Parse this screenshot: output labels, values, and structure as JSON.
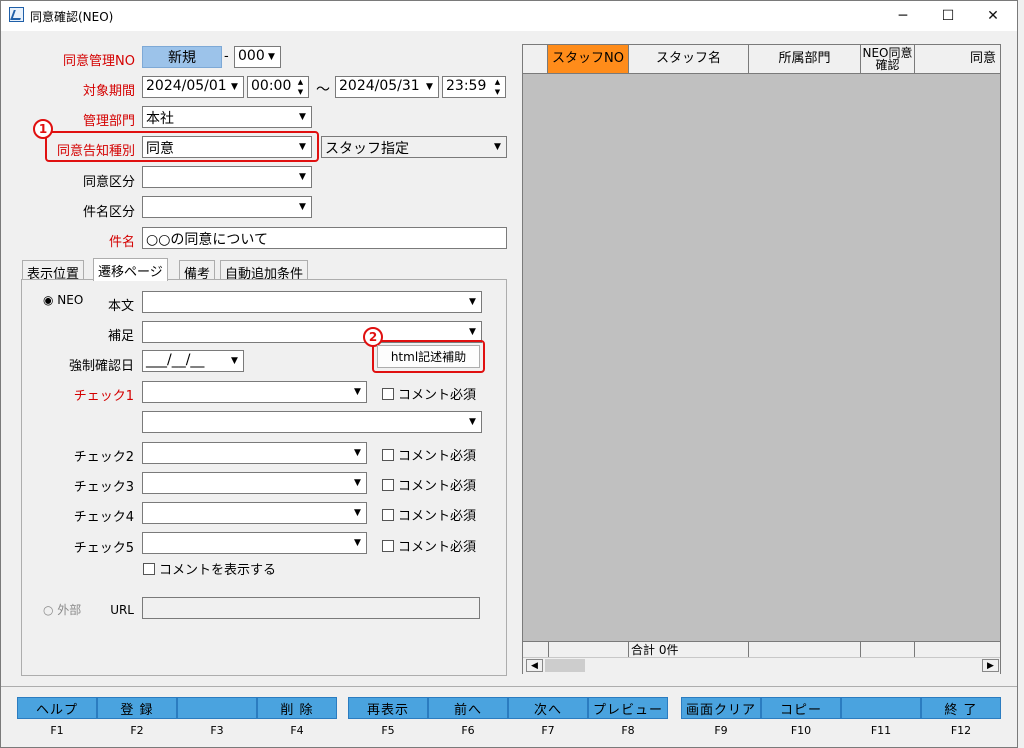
{
  "window": {
    "title": "同意確認(NEO)"
  },
  "form": {
    "mgmt_no_label": "同意管理NO",
    "mgmt_no_value": "新規",
    "mgmt_no_dash": "-",
    "mgmt_no_sub": "000",
    "period_label": "対象期間",
    "period_from_date": "2024/05/01",
    "period_from_time": "00:00",
    "period_sep": "～",
    "period_to_date": "2024/05/31",
    "period_to_time": "23:59",
    "dept_label": "管理部門",
    "dept_value": "本社",
    "notice_type_label": "同意告知種別",
    "notice_type_value": "同意",
    "staff_spec_value": "スタッフ指定",
    "consent_class_label": "同意区分",
    "subject_class_label": "件名区分",
    "subject_label": "件名",
    "subject_value": "○○の同意について"
  },
  "tabs": [
    "表示位置",
    "遷移ページ",
    "備考",
    "自動追加条件"
  ],
  "panel": {
    "neo_radio": "NEO",
    "body_label": "本文",
    "supplement_label": "補足",
    "force_date_label": "強制確認日",
    "force_date_value": "___/__/__",
    "html_button": "html記述補助",
    "check1_label": "チェック1",
    "check2_label": "チェック2",
    "check3_label": "チェック3",
    "check4_label": "チェック4",
    "check5_label": "チェック5",
    "comment_required": "コメント必須",
    "show_comment": "コメントを表示する",
    "external_radio": "外部",
    "url_label": "URL"
  },
  "grid": {
    "columns": [
      "スタッフNO",
      "スタッフ名",
      "所属部門",
      "NEO同意確認",
      "同意"
    ],
    "footer_total": "合計 0件"
  },
  "badges": [
    "1",
    "2"
  ],
  "fkeys": [
    {
      "label": "ヘルプ",
      "key": "F1"
    },
    {
      "label": "登 録",
      "key": "F2"
    },
    {
      "label": "",
      "key": "F3"
    },
    {
      "label": "削 除",
      "key": "F4"
    },
    {
      "label": "再表示",
      "key": "F5"
    },
    {
      "label": "前へ",
      "key": "F6"
    },
    {
      "label": "次へ",
      "key": "F7"
    },
    {
      "label": "プレビュー",
      "key": "F8"
    },
    {
      "label": "画面クリア",
      "key": "F9"
    },
    {
      "label": "コピー",
      "key": "F10"
    },
    {
      "label": "",
      "key": "F11"
    },
    {
      "label": "終 了",
      "key": "F12"
    }
  ],
  "colors": {
    "accent": "#4aa3df",
    "highlight_col": "#ff8c1a",
    "annotation": "#e01010",
    "required_label": "#d40000"
  }
}
